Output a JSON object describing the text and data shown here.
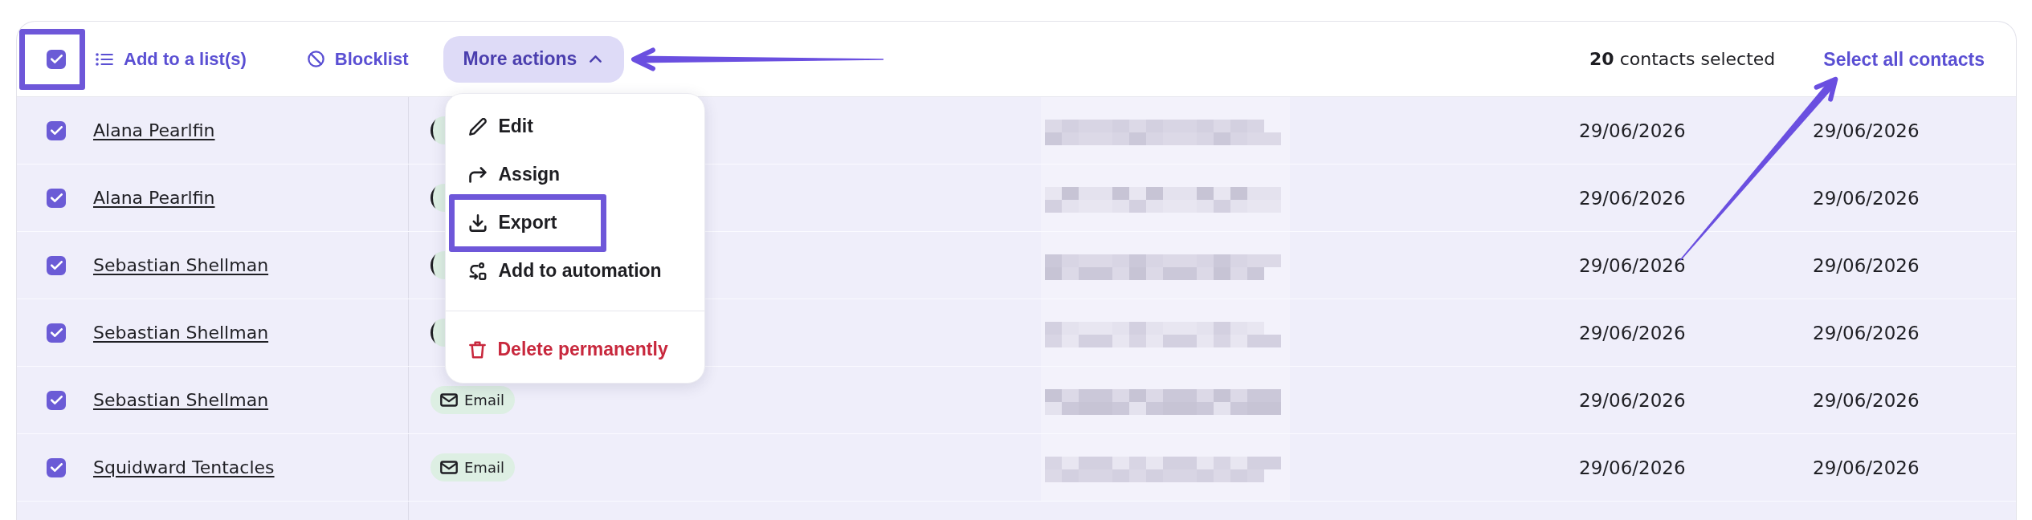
{
  "toolbar": {
    "select_all_checkbox": {
      "checked": true,
      "highlighted": true
    },
    "actions": [
      {
        "kind": "list",
        "label": "Add to a list(s)"
      },
      {
        "kind": "blocklist",
        "label": "Blocklist"
      }
    ],
    "more_actions": {
      "label": "More actions",
      "expanded": true,
      "arrow_annotation": true,
      "menu": [
        {
          "kind": "edit",
          "label": "Edit",
          "highlighted": false
        },
        {
          "kind": "assign",
          "label": "Assign",
          "highlighted": false
        },
        {
          "kind": "export",
          "label": "Export",
          "highlighted": true
        },
        {
          "kind": "automation",
          "label": "Add to automation",
          "highlighted": false
        },
        {
          "kind": "delete",
          "label": "Delete permanently",
          "highlighted": false
        }
      ]
    },
    "selection_count": "**20** contacts selected",
    "select_all_link": {
      "label": "Select all contacts",
      "arrow_annotation": true
    }
  },
  "rows": [
    {
      "name": "Alana Pearlfin",
      "selected": true,
      "badge": {
        "covered": true
      },
      "column_4": "29/06/2026",
      "column_5": "29/06/2026"
    },
    {
      "name": "Alana Pearlfin",
      "selected": true,
      "badge": {
        "covered": true
      },
      "column_4": "29/06/2026",
      "column_5": "29/06/2026"
    },
    {
      "name": "Sebastian Shellman",
      "selected": true,
      "badge": {
        "covered": true
      },
      "column_4": "29/06/2026",
      "column_5": "29/06/2026"
    },
    {
      "name": "Sebastian Shellman",
      "selected": true,
      "badge": {
        "covered": true
      },
      "column_4": "29/06/2026",
      "column_5": "29/06/2026"
    },
    {
      "name": "Sebastian Shellman",
      "selected": true,
      "badge": {
        "kind": "email",
        "label": "Email"
      },
      "column_4": "29/06/2026",
      "column_5": "29/06/2026"
    },
    {
      "name": "Squidward Tentacles",
      "selected": true,
      "badge": {
        "kind": "email",
        "label": "Email"
      },
      "column_4": "29/06/2026",
      "column_5": "29/06/2026"
    }
  ]
}
